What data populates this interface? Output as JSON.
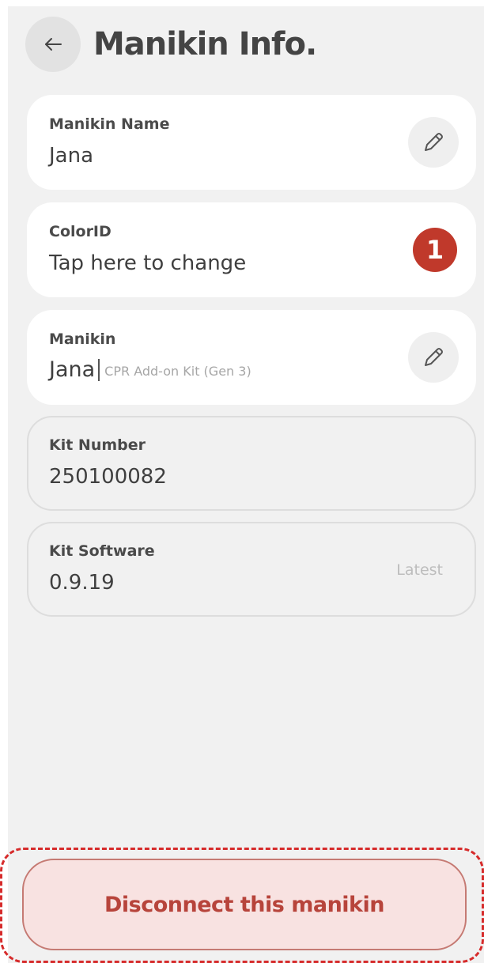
{
  "header": {
    "back_icon": "arrow-left-icon",
    "title": "Manikin Info."
  },
  "cards": {
    "name": {
      "label": "Manikin Name",
      "value": "Jana",
      "action_icon": "pencil-icon"
    },
    "color": {
      "label": "ColorID",
      "value": "Tap here to change",
      "badge": "1"
    },
    "manikin": {
      "label": "Manikin",
      "value": "Jana",
      "subvalue": "CPR Add-on Kit (Gen 3)",
      "action_icon": "pencil-icon"
    },
    "kit_number": {
      "label": "Kit Number",
      "value": "250100082"
    },
    "kit_software": {
      "label": "Kit Software",
      "value": "0.9.19",
      "status": "Latest"
    }
  },
  "footer": {
    "disconnect_label": "Disconnect this manikin"
  },
  "colors": {
    "background": "#f1f1f1",
    "card": "#ffffff",
    "badge": "#c0392b",
    "danger_text": "#b7443b",
    "danger_fill": "#f8e2e1",
    "highlight": "#d62b2b"
  }
}
